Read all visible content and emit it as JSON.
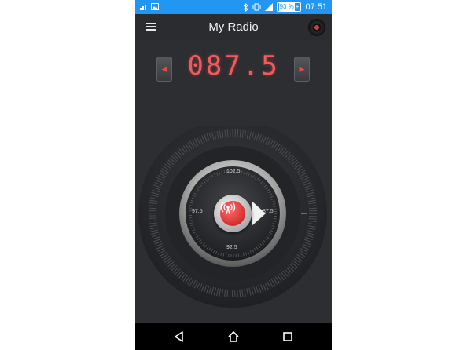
{
  "status_bar": {
    "battery_percent": "93 %",
    "time": "07:51",
    "icons": [
      "signal-bars-icon",
      "image-icon",
      "bluetooth-icon",
      "vibrate-icon",
      "cell-signal-icon",
      "battery-icon"
    ]
  },
  "app_bar": {
    "title": "My Radio",
    "menu_icon": "hamburger-menu-icon",
    "record_icon": "vinyl-record-icon"
  },
  "tuner": {
    "frequency": "087.5",
    "prev_icon": "arrow-left-icon",
    "next_icon": "arrow-right-icon"
  },
  "dial": {
    "labels": {
      "top": "102.5",
      "left": "97.5",
      "right": "87.5",
      "bottom": "92.5"
    },
    "center_icon": "broadcast-antenna-icon"
  },
  "nav_bar": {
    "icons": [
      "back-icon",
      "home-icon",
      "recents-icon"
    ]
  },
  "colors": {
    "status_bar": "#2196f3",
    "background": "#2d2e31",
    "accent_red": "#f05b5b"
  }
}
